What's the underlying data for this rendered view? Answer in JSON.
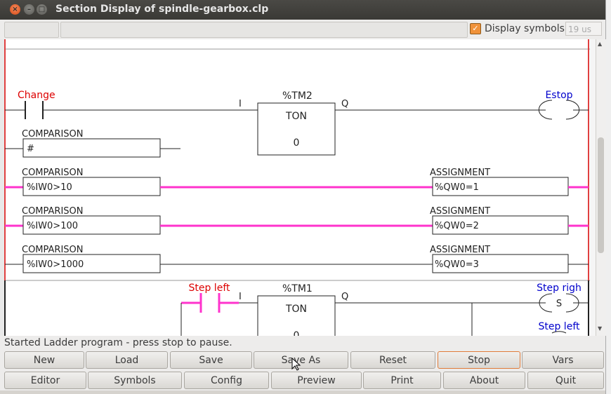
{
  "window": {
    "title": "Section Display of spindle-gearbox.clp",
    "close": "×",
    "min": "–",
    "max": "□"
  },
  "toolbar": {
    "display_symbols_label": "Display symbols",
    "display_symbols_checked": true,
    "check_mark": "✓",
    "timing": "19 us"
  },
  "ladder": {
    "rung1": {
      "contact_symbol": "Change",
      "timer_name": "%TM2",
      "timer_type": "TON",
      "timer_value": "0",
      "input_label": "I",
      "output_label": "Q",
      "coil_symbol": "Estop",
      "comparison_header": "COMPARISON",
      "comparison_expr": "#"
    },
    "rung2": {
      "comparison_header": "COMPARISON",
      "comparison_expr": "%IW0>10",
      "assignment_header": "ASSIGNMENT",
      "assignment_expr": "%QW0=1"
    },
    "rung3": {
      "comparison_header": "COMPARISON",
      "comparison_expr": "%IW0>100",
      "assignment_header": "ASSIGNMENT",
      "assignment_expr": "%QW0=2"
    },
    "rung4": {
      "comparison_header": "COMPARISON",
      "comparison_expr": "%IW0>1000",
      "assignment_header": "ASSIGNMENT",
      "assignment_expr": "%QW0=3"
    },
    "rung5": {
      "contact_symbol": "Step left",
      "timer_name": "%TM1",
      "timer_type": "TON",
      "timer_value": "0",
      "input_label": "I",
      "output_label": "Q",
      "coil1_symbol": "Step righ",
      "coil1_letter": "S",
      "coil2_symbol": "Step left"
    },
    "colors": {
      "active": "#ff33cc",
      "rail": "#e04040",
      "symbol_red": "#dd0000",
      "symbol_blue": "#0000cc"
    }
  },
  "status": "Started Ladder program - press stop to pause.",
  "buttons_row1": [
    "New",
    "Load",
    "Save",
    "Save As",
    "Reset",
    "Stop",
    "Vars"
  ],
  "buttons_row2": [
    "Editor",
    "Symbols",
    "Config",
    "Preview",
    "Print",
    "About",
    "Quit"
  ]
}
